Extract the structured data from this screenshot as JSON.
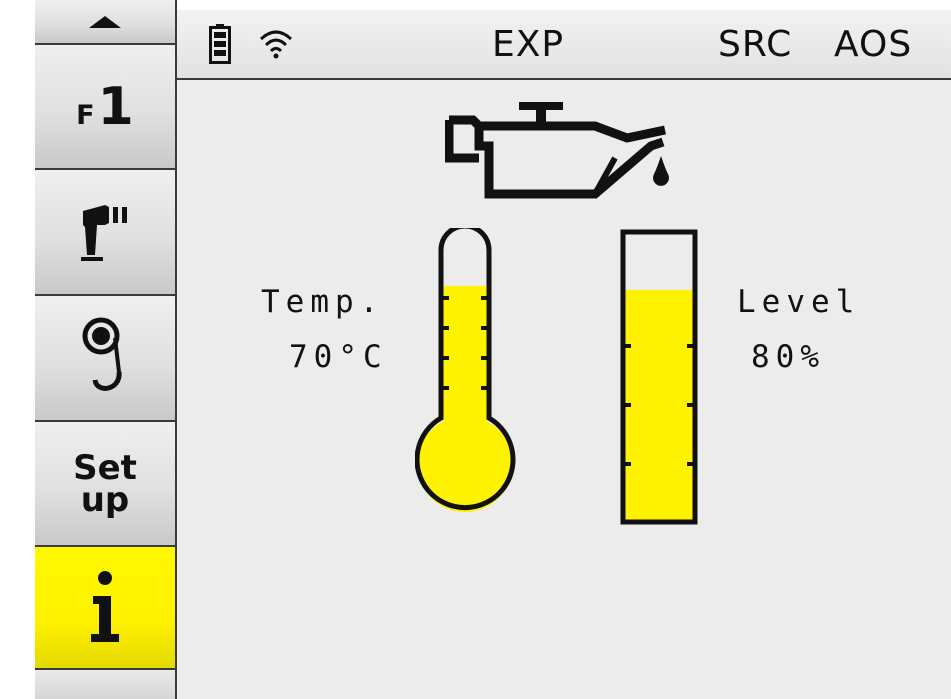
{
  "status_bar": {
    "battery_icon": "battery-icon",
    "wifi_icon": "wifi-icon",
    "mode": "EXP",
    "src": "SRC",
    "aos": "AOS"
  },
  "sidebar": {
    "scroll_up_icon": "triangle-up-icon",
    "items": [
      {
        "prefix": "F",
        "number": "1"
      },
      {
        "icon": "pipe-tool-icon"
      },
      {
        "icon": "winch-hook-icon"
      },
      {
        "line1": "Set",
        "line2": "up"
      },
      {
        "icon": "info-icon",
        "selected": true
      }
    ]
  },
  "oil": {
    "icon": "oil-can-icon",
    "temp_label": "Temp.",
    "temp_value": "70°C",
    "temp_fill_fraction": 0.7,
    "level_label": "Level",
    "level_value": "80%",
    "level_fraction": 0.8
  },
  "colors": {
    "accent": "#fff200",
    "panel_bg": "#ececec",
    "outline": "#111111"
  }
}
